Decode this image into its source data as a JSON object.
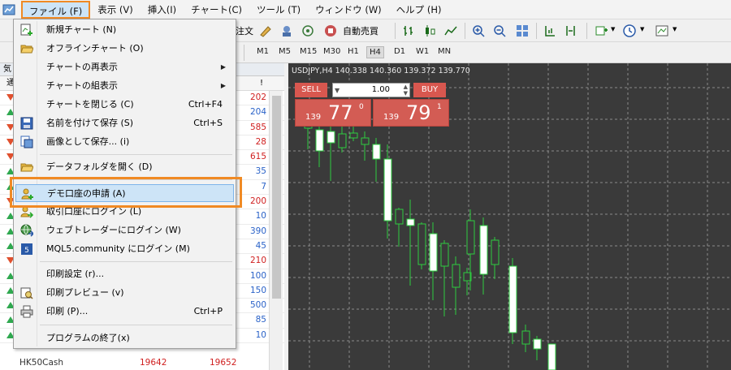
{
  "menubar": {
    "items": [
      {
        "label": "ファイル (F)"
      },
      {
        "label": "表示 (V)"
      },
      {
        "label": "挿入(I)"
      },
      {
        "label": "チャート(C)"
      },
      {
        "label": "ツール (T)"
      },
      {
        "label": "ウィンドウ (W)"
      },
      {
        "label": "ヘルプ (H)"
      }
    ]
  },
  "toolbar": {
    "auto_trade_label": "自動売買",
    "truncated_label": "注文"
  },
  "timeframes": [
    "M1",
    "M5",
    "M15",
    "M30",
    "H1",
    "H4",
    "D1",
    "W1",
    "MN"
  ],
  "active_timeframe": "H4",
  "market_watch": {
    "header_prefix": "気",
    "column_prefix": "通",
    "column_marker": "!",
    "values": [
      {
        "v": "202",
        "dir": "down",
        "color": "red"
      },
      {
        "v": "204",
        "dir": "up",
        "color": "blue"
      },
      {
        "v": "585",
        "dir": "down",
        "color": "red"
      },
      {
        "v": "28",
        "dir": "down",
        "color": "red"
      },
      {
        "v": "615",
        "dir": "down",
        "color": "red"
      },
      {
        "v": "35",
        "dir": "up",
        "color": "blue"
      },
      {
        "v": "7",
        "dir": "up",
        "color": "blue"
      },
      {
        "v": "200",
        "dir": "down",
        "color": "red"
      },
      {
        "v": "10",
        "dir": "up",
        "color": "blue"
      },
      {
        "v": "390",
        "dir": "up",
        "color": "blue"
      },
      {
        "v": "45",
        "dir": "up",
        "color": "blue"
      },
      {
        "v": "210",
        "dir": "down",
        "color": "red"
      },
      {
        "v": "100",
        "dir": "up",
        "color": "blue"
      },
      {
        "v": "150",
        "dir": "up",
        "color": "blue"
      },
      {
        "v": "500",
        "dir": "up",
        "color": "blue"
      },
      {
        "v": "85",
        "dir": "up",
        "color": "blue"
      },
      {
        "v": "10",
        "dir": "up",
        "color": "blue"
      }
    ],
    "bottom_row": {
      "symbol": "HK50Cash",
      "bid": "19642",
      "ask": "19652"
    }
  },
  "chart": {
    "info": "USDJPY,H4  140.338  140.360  139.372  139.770"
  },
  "trade": {
    "sell_label": "SELL",
    "buy_label": "BUY",
    "volume": "1.00",
    "sell_prefix": "139",
    "sell_big": "77",
    "sell_sup": "0",
    "buy_prefix": "139",
    "buy_big": "79",
    "buy_sup": "1"
  },
  "file_menu": {
    "items": [
      {
        "label": "新規チャート (N)",
        "shortcut": "",
        "submenu": false
      },
      {
        "label": "オフラインチャート (O)",
        "shortcut": "",
        "submenu": false
      },
      {
        "label": "チャートの再表示",
        "shortcut": "",
        "submenu": true
      },
      {
        "label": "チャートの組表示",
        "shortcut": "",
        "submenu": true
      },
      {
        "label": "チャートを閉じる (C)",
        "shortcut": "Ctrl+F4",
        "submenu": false
      },
      {
        "label": "名前を付けて保存 (S)",
        "shortcut": "Ctrl+S",
        "submenu": false
      },
      {
        "label": "画像として保存... (i)",
        "shortcut": "",
        "submenu": false
      },
      {
        "label": "データフォルダを開く (D)",
        "shortcut": "",
        "submenu": false
      },
      {
        "label": "デモ口座の申請 (A)",
        "shortcut": "",
        "submenu": false
      },
      {
        "label": "取引口座にログイン (L)",
        "shortcut": "",
        "submenu": false
      },
      {
        "label": "ウェブトレーダーにログイン (W)",
        "shortcut": "",
        "submenu": false
      },
      {
        "label": "MQL5.community にログイン (M)",
        "shortcut": "",
        "submenu": false
      },
      {
        "label": "印刷設定 (r)...",
        "shortcut": "",
        "submenu": false
      },
      {
        "label": "印刷プレビュー (v)",
        "shortcut": "",
        "submenu": false
      },
      {
        "label": "印刷 (P)...",
        "shortcut": "Ctrl+P",
        "submenu": false
      },
      {
        "label": "プログラムの終了(x)",
        "shortcut": "",
        "submenu": false
      }
    ],
    "highlighted": "デモ口座の申請 (A)"
  },
  "colors": {
    "highlight_border": "#f08a24",
    "menu_highlight": "#cde4f7",
    "chart_bg": "#3a3a3a",
    "candle_bull": "#ffffff",
    "candle_bear": "#3a3a3a",
    "wick": "#2ecc40",
    "trade_red": "#d35c54"
  }
}
